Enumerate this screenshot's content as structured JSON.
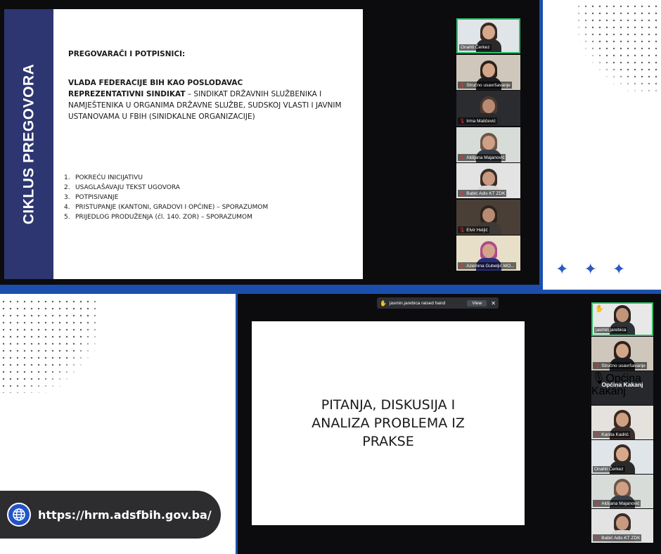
{
  "top_meeting": {
    "slide": {
      "band_title": "CIKLUS PREGOVORA",
      "heading": "PREGOVARAČI I POTPISNICI:",
      "line1": "VLADA FEDERACIJE BIH KAO POSLODAVAC",
      "line2_bold": "REPREZENTATIVNI SINDIKAT",
      "line2_rest": " – SINDIKAT DRŽAVNIH SLUŽBENIKA I NAMJEŠTENIKA U ORGANIMA DRŽAVNE SLUŽBE, SUDSKOJ VLASTI I JAVNIM USTANOVAMA U FBIH (SINIDKALNE ORGANIZACIJE)",
      "list": [
        {
          "num": "1.",
          "text": "POKREĆU INICIJATIVU"
        },
        {
          "num": "2.",
          "text": "USAGLAŠAVAJU TEKST UGOVORA"
        },
        {
          "num": "3.",
          "text": "POTPISIVANJE"
        },
        {
          "num": "4.",
          "text": "PRISTUPANJE (KANTONI, GRADOVI I OPĆINE) – SPORAZUMOM"
        },
        {
          "num": "5.",
          "text": "PRIJEDLOG PRODUŽENJA (čl. 140. ZOR) – SPORAZUMOM"
        }
      ]
    },
    "participants": [
      {
        "name": "Onahti Čerkez",
        "muted": false,
        "active": true,
        "skin": "#d6a98c",
        "hair": "#3b2a22",
        "shirt": "#2a2a2a",
        "wall": "#dfe5e8"
      },
      {
        "name": "Stručno usavršavanje",
        "muted": true,
        "active": false,
        "skin": "#d3a689",
        "hair": "#2e211b",
        "shirt": "#1e1e22",
        "wall": "#cfc7bb"
      },
      {
        "name": "Irma Maličević",
        "muted": true,
        "active": false,
        "skin": "#b98a72",
        "hair": "#4a3a30",
        "shirt": "#2a2a2e",
        "wall": "#2a2c30"
      },
      {
        "name": "Aldijana Majanović",
        "muted": true,
        "active": false,
        "skin": "#cf9f86",
        "hair": "#6b5646",
        "shirt": "#3a3f47",
        "wall": "#d8dcd8"
      },
      {
        "name": "Babić Adis KT ZDK",
        "muted": true,
        "active": false,
        "skin": "#c89a80",
        "hair": "#3a2d26",
        "shirt": "#d8d8d8",
        "wall": "#e3e3e3"
      },
      {
        "name": "Elvir Heljić",
        "muted": true,
        "active": false,
        "skin": "#b88b72",
        "hair": "#2d241f",
        "shirt": "#3e3a36",
        "wall": "#4a3f36"
      },
      {
        "name": "Azemina Gubeljić MO...",
        "muted": true,
        "active": false,
        "skin": "#d2a58a",
        "hair": "#b14a8c",
        "shirt": "#2b2e78",
        "wall": "#e8dfc9"
      }
    ]
  },
  "bottom_meeting": {
    "notification": {
      "text": "jasmin.jarebica raised hand",
      "view_label": "View",
      "close_label": "✕"
    },
    "slide_title": "PITANJA, DISKUSIJA I ANALIZA PROBLEMA IZ PRAKSE",
    "participants": [
      {
        "name": "jasmin.jarebica",
        "muted": false,
        "active": true,
        "raised_hand": true,
        "skin": "#c29479",
        "hair": "#2a2420",
        "shirt": "#2e3136",
        "wall": "#e8e8e8"
      },
      {
        "name": "Stručno usavršavanje",
        "muted": true,
        "active": false,
        "skin": "#d3a689",
        "hair": "#2e211b",
        "shirt": "#1e1e22",
        "wall": "#cfc7bb"
      },
      {
        "name": "Općina Kakanj",
        "muted": true,
        "org_tile": true,
        "org_label": "Općina Kakanj"
      },
      {
        "name": "Kanita Kadrić",
        "muted": true,
        "active": false,
        "skin": "#d0a085",
        "hair": "#3a2a20",
        "shirt": "#3a3030",
        "wall": "#e5e2dd"
      },
      {
        "name": "Onahti Čerkez",
        "muted": false,
        "active": false,
        "skin": "#d6a98c",
        "hair": "#3b2a22",
        "shirt": "#2a2a2a",
        "wall": "#dfe5e8"
      },
      {
        "name": "Aldijana Majanović",
        "muted": true,
        "active": false,
        "skin": "#cf9f86",
        "hair": "#6b5646",
        "shirt": "#3a3f47",
        "wall": "#d8dcd8"
      },
      {
        "name": "Babić Adis KT ZDK",
        "muted": true,
        "active": false,
        "skin": "#c89a80",
        "hair": "#3a2d26",
        "shirt": "#d8d8d8",
        "wall": "#e3e3e3"
      }
    ]
  },
  "footer": {
    "url": "https://hrm.adsfbih.gov.ba/",
    "icon": "globe-icon"
  },
  "decor": {
    "sparkle": "✦",
    "accent": "#1b4fae"
  }
}
